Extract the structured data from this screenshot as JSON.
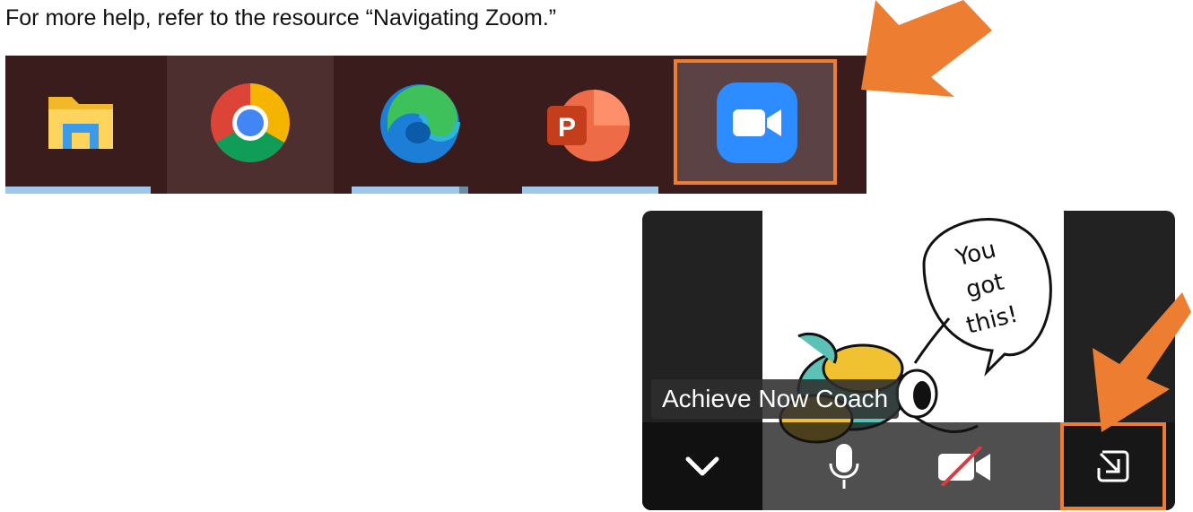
{
  "instruction": "For more help, refer to the resource “Navigating Zoom.”",
  "taskbar": {
    "items": [
      {
        "name": "File Explorer",
        "icon": "folder-icon"
      },
      {
        "name": "Google Chrome",
        "icon": "chrome-icon"
      },
      {
        "name": "Microsoft Edge",
        "icon": "edge-icon"
      },
      {
        "name": "PowerPoint",
        "icon": "powerpoint-icon",
        "letter": "P"
      },
      {
        "name": "Zoom",
        "icon": "zoom-video-icon"
      }
    ]
  },
  "zoom_window": {
    "participant_name": "Achieve Now Coach",
    "speech_bubble": [
      "You",
      "got",
      "this!"
    ],
    "controls": [
      "chevron-down-icon",
      "microphone-icon",
      "video-off-icon",
      "exit-minimized-icon"
    ]
  },
  "colors": {
    "highlight": "#ed7d31",
    "taskbar_bg": "#3b1c1d",
    "zoom_blue": "#2d8cff",
    "indicator": "#9fc7ea"
  }
}
